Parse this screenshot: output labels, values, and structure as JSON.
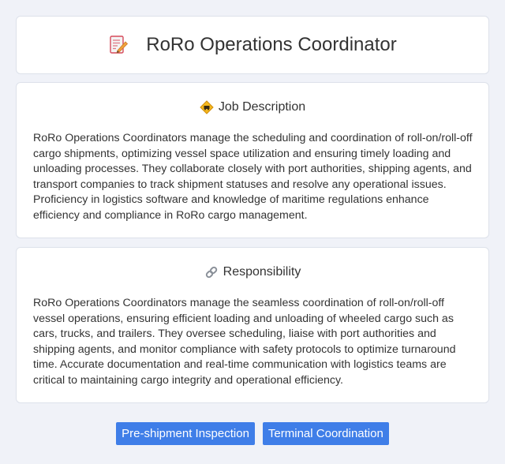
{
  "header": {
    "title": "RoRo Operations Coordinator",
    "icon": "memo-pencil-icon"
  },
  "job_description": {
    "heading": "Job Description",
    "icon": "diamond-sign-icon",
    "body": "RoRo Operations Coordinators manage the scheduling and coordination of roll-on/roll-off cargo shipments, optimizing vessel space utilization and ensuring timely loading and unloading processes. They collaborate closely with port authorities, shipping agents, and transport companies to track shipment statuses and resolve any operational issues. Proficiency in logistics software and knowledge of maritime regulations enhance efficiency and compliance in RoRo cargo management."
  },
  "responsibility": {
    "heading": "Responsibility",
    "icon": "link-icon",
    "body": "RoRo Operations Coordinators manage the seamless coordination of roll-on/roll-off vessel operations, ensuring efficient loading and unloading of wheeled cargo such as cars, trucks, and trailers. They oversee scheduling, liaise with port authorities and shipping agents, and monitor compliance with safety protocols to optimize turnaround time. Accurate documentation and real-time communication with logistics teams are critical to maintaining cargo integrity and operational efficiency."
  },
  "tags": [
    "Pre-shipment Inspection",
    "Terminal Coordination"
  ],
  "colors": {
    "background": "#f0f2f8",
    "card": "#ffffff",
    "tag": "#3f7ee8",
    "text": "#333333"
  }
}
